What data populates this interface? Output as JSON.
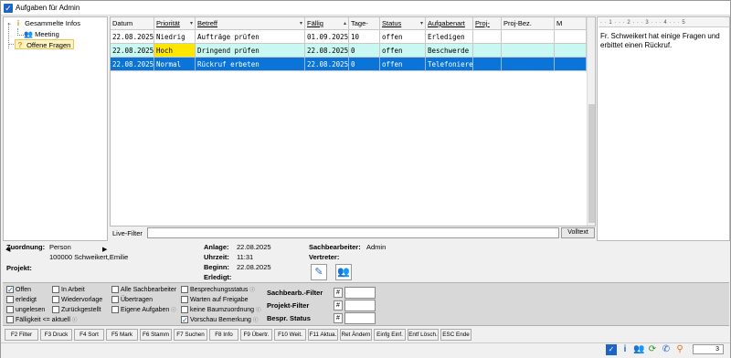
{
  "window": {
    "title": "Aufgaben für Admin"
  },
  "tree": {
    "items": [
      {
        "label": "Gesammelte Infos",
        "icon": "info-icon"
      },
      {
        "label": "Meeting",
        "icon": "people-icon"
      },
      {
        "label": "Offene Fragen",
        "icon": "question-icon"
      }
    ]
  },
  "grid": {
    "headers": [
      "Datum",
      "Priorität",
      "Betreff",
      "Fällig",
      "Tage-",
      "Status",
      "Aufgabenart",
      "Proj-",
      "Proj-Bez.",
      "M"
    ],
    "rows": [
      [
        "22.08.2025",
        "Niedrig",
        "Aufträge prüfen",
        "01.09.2025",
        "10",
        "offen",
        "Erledigen",
        "",
        "",
        ""
      ],
      [
        "22.08.2025",
        "Hoch",
        "Dringend prüfen",
        "22.08.2025",
        "0",
        "offen",
        "Beschwerde",
        "",
        "",
        ""
      ],
      [
        "22.08.2025",
        "Normal",
        "Rückruf erbeten",
        "22.08.2025",
        "0",
        "offen",
        "Telefonieren",
        "",
        "",
        ""
      ]
    ],
    "colors": {
      "row2_bg": "#c9f7f2",
      "hoch_bg": "#ffe600",
      "selected_bg": "#0a74d8"
    }
  },
  "note": {
    "ruler": "· · 1 · · · 2 · · · 3 · · · 4 · · · 5",
    "text": "Fr. Schweikert hat einige Fragen und erbittet einen Rückruf."
  },
  "live_filter": {
    "label": "Live-Filter",
    "value": "",
    "button": "Volltext"
  },
  "details": {
    "zuordnung_label": "Zuordnung:",
    "zuordnung_value": "Person",
    "zuordnung_person": "100000 Schweikert,Emilie",
    "projekt_label": "Projekt:",
    "anlage_label": "Anlage:",
    "anlage_value": "22.08.2025",
    "uhrzeit_label": "Uhrzeit:",
    "uhrzeit_value": "11:31",
    "beginn_label": "Beginn:",
    "beginn_value": "22.08.2025",
    "erledigt_label": "Erledigt:",
    "sachbearbeiter_label": "Sachbearbeiter:",
    "sachbearbeiter_value": "Admin",
    "vertreter_label": "Vertreter:"
  },
  "filters": {
    "col1": [
      {
        "label": "Offen",
        "checked": true
      },
      {
        "label": "erledigt",
        "checked": false
      },
      {
        "label": "ungelesen",
        "checked": false
      },
      {
        "label": "Fälligkeit <= aktuell",
        "checked": false,
        "info": "ⓘ"
      }
    ],
    "col2": [
      {
        "label": "In Arbeit",
        "checked": false
      },
      {
        "label": "Wiedervorlage",
        "checked": false
      },
      {
        "label": "Zurückgestellt",
        "checked": false
      }
    ],
    "col3": [
      {
        "label": "Alle Sachbearbeiter",
        "checked": false
      },
      {
        "label": "Übertragen",
        "checked": false
      },
      {
        "label": "Eigene Aufgaben",
        "checked": false,
        "info": "ⓘ"
      }
    ],
    "col4": [
      {
        "label": "Besprechungsstatus",
        "checked": false,
        "info": "ⓘ"
      },
      {
        "label": "Warten auf Freigabe",
        "checked": false
      },
      {
        "label": "keine Baumzuordnung",
        "checked": false,
        "info": "ⓘ"
      },
      {
        "label": "Vorschau Bemerkung",
        "checked": true,
        "info": "ⓘ"
      }
    ],
    "sachbearb_filter": "Sachbearb.-Filter",
    "projekt_filter": "Projekt-Filter",
    "bespr_status": "Bespr. Status",
    "hash": "#"
  },
  "fkeys": [
    "F2 Filter",
    "F3 Druck",
    "F4 Sort",
    "F5 Mark",
    "F6 Stamm",
    "F7 Suchen",
    "F8 Info",
    "F9 Übertr.",
    "F10 Weit.",
    "F11 Aktua.",
    "Ret Ändern",
    "Einfg Einf.",
    "Entf Lösch.",
    "ESC Ende"
  ],
  "status": {
    "page": "3"
  }
}
